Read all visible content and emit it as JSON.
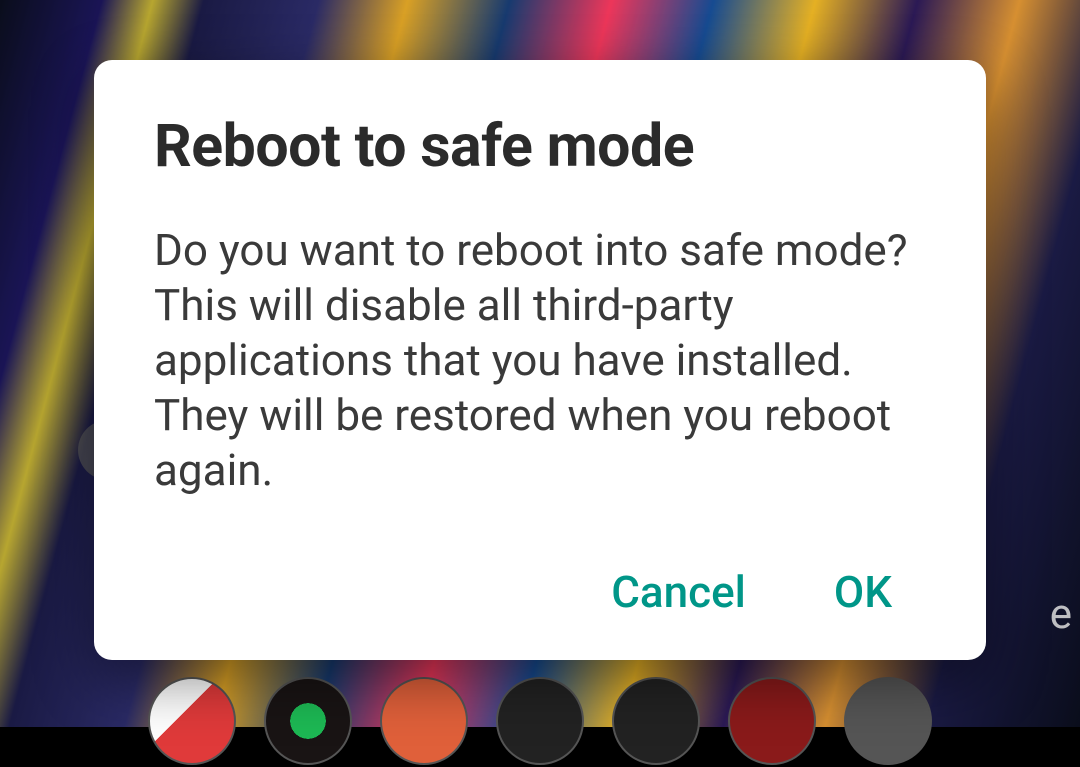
{
  "dialog": {
    "title": "Reboot to safe mode",
    "message": "Do you want to reboot into safe mode? This will disable all third-party applications that you have installed. They will be restored when you reboot again.",
    "cancel_label": "Cancel",
    "ok_label": "OK"
  },
  "colors": {
    "accent": "#009688",
    "title_text": "#2b2b2b",
    "body_text": "#3a3a3a",
    "dialog_bg": "#ffffff"
  }
}
